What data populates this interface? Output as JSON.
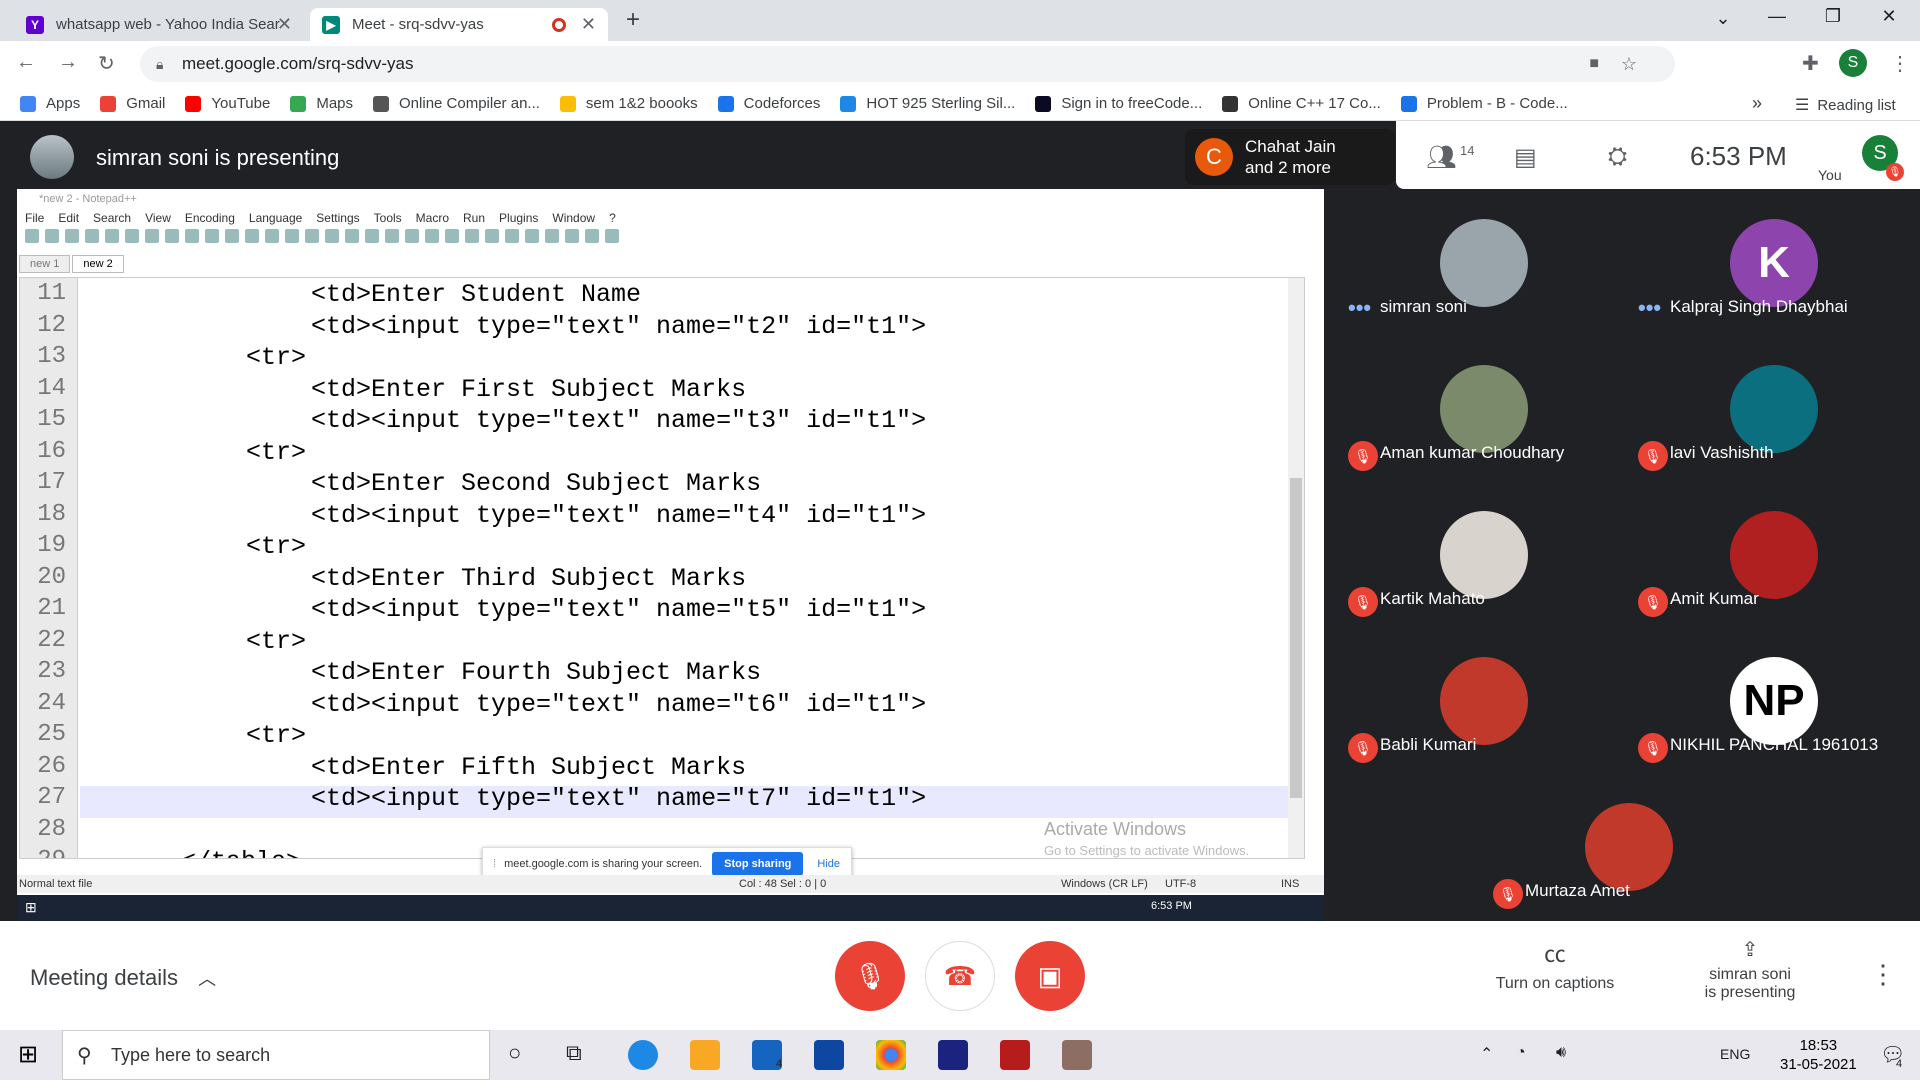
{
  "browser": {
    "tabs": [
      {
        "title": "whatsapp web - Yahoo India Sear",
        "favicon": "yahoo-icon",
        "active": false
      },
      {
        "title": "Meet - srq-sdvv-yas",
        "favicon": "meet-icon",
        "active": true
      }
    ],
    "new_tab": "+",
    "url": "meet.google.com/srq-sdvv-yas",
    "profile_initial": "S",
    "bookmarks": [
      {
        "label": "Apps",
        "icon": "apps-grid-icon",
        "color": "#4285f4"
      },
      {
        "label": "Gmail",
        "icon": "gmail-icon",
        "color": "#ea4335"
      },
      {
        "label": "YouTube",
        "icon": "youtube-icon",
        "color": "#ff0000"
      },
      {
        "label": "Maps",
        "icon": "maps-icon",
        "color": "#34a853"
      },
      {
        "label": "Online Compiler an...",
        "icon": "compiler-icon",
        "color": "#555555"
      },
      {
        "label": "sem 1&2 boooks",
        "icon": "drive-icon",
        "color": "#fbbc04"
      },
      {
        "label": "Codeforces",
        "icon": "codeforces-icon",
        "color": "#1a73e8"
      },
      {
        "label": "HOT 925 Sterling Sil...",
        "icon": "shop-icon",
        "color": "#1e88e5"
      },
      {
        "label": "Sign in to freeCode...",
        "icon": "freecodecamp-icon",
        "color": "#0a0a23"
      },
      {
        "label": "Online C++ 17 Co...",
        "icon": "cpp-icon",
        "color": "#333333"
      },
      {
        "label": "Problem - B - Code...",
        "icon": "codeforces-icon",
        "color": "#1a73e8"
      }
    ],
    "bookmarks_overflow": "»",
    "reading_list": "Reading list"
  },
  "meet": {
    "presenting_title": "simran soni is presenting",
    "notification": {
      "initial": "C",
      "line1": "Chahat Jain",
      "line2": "and 2 more"
    },
    "participant_count": "14",
    "time": "6:53 PM",
    "you_label": "You",
    "you_initial": "S",
    "participants": [
      {
        "name": "simran soni",
        "avatar": "photo",
        "color": "#9aa5ab",
        "status": "speaking"
      },
      {
        "name": "Kalpraj Singh Dhaybhai",
        "avatar": "K",
        "color": "#8e44ad",
        "status": "speaking"
      },
      {
        "name": "Aman kumar Choudhary",
        "avatar": "photo",
        "color": "#7a8a6a",
        "status": "muted"
      },
      {
        "name": "lavi Vashishth",
        "avatar": "photo",
        "color": "#0b6f7f",
        "status": "muted"
      },
      {
        "name": "Kartik Mahato",
        "avatar": "photo",
        "color": "#d8d3cc",
        "status": "muted"
      },
      {
        "name": "Amit Kumar",
        "avatar": "photo",
        "color": "#b12020",
        "status": "muted"
      },
      {
        "name": "Babli Kumari",
        "avatar": "photo",
        "color": "#c0392b",
        "status": "muted"
      },
      {
        "name": "NIKHIL PANCHAL 1961013",
        "avatar": "NP",
        "color": "#ffffff",
        "status": "muted"
      },
      {
        "name": "Murtaza Amet",
        "avatar": "photo",
        "color": "#c0392b",
        "status": "muted"
      }
    ],
    "meeting_details": "Meeting details",
    "captions_label": "Turn on captions",
    "presenting_label_1": "simran soni",
    "presenting_label_2": "is presenting"
  },
  "notepad": {
    "title": "*new 2 - Notepad++",
    "menu": [
      "File",
      "Edit",
      "Search",
      "View",
      "Encoding",
      "Language",
      "Settings",
      "Tools",
      "Macro",
      "Run",
      "Plugins",
      "Window",
      "?"
    ],
    "tabs": [
      "new 1",
      "new 2"
    ],
    "lines": [
      {
        "n": "11",
        "text": "<td>Enter Student Name",
        "indent": 3
      },
      {
        "n": "12",
        "text": "<td><input type=\"text\" name=\"t2\" id=\"t1\">",
        "indent": 3
      },
      {
        "n": "13",
        "text": "<tr>",
        "indent": 2
      },
      {
        "n": "14",
        "text": "<td>Enter First Subject Marks",
        "indent": 3
      },
      {
        "n": "15",
        "text": "<td><input type=\"text\" name=\"t3\" id=\"t1\">",
        "indent": 3
      },
      {
        "n": "16",
        "text": "<tr>",
        "indent": 2
      },
      {
        "n": "17",
        "text": "<td>Enter Second Subject Marks",
        "indent": 3
      },
      {
        "n": "18",
        "text": "<td><input type=\"text\" name=\"t4\" id=\"t1\">",
        "indent": 3
      },
      {
        "n": "19",
        "text": "<tr>",
        "indent": 2
      },
      {
        "n": "20",
        "text": "<td>Enter Third Subject Marks",
        "indent": 3
      },
      {
        "n": "21",
        "text": "<td><input type=\"text\" name=\"t5\" id=\"t1\">",
        "indent": 3
      },
      {
        "n": "22",
        "text": "<tr>",
        "indent": 2
      },
      {
        "n": "23",
        "text": "<td>Enter Fourth Subject Marks",
        "indent": 3
      },
      {
        "n": "24",
        "text": "<td><input type=\"text\" name=\"t6\" id=\"t1\">",
        "indent": 3
      },
      {
        "n": "25",
        "text": "<tr>",
        "indent": 2
      },
      {
        "n": "26",
        "text": "<td>Enter Fifth Subject Marks",
        "indent": 3
      },
      {
        "n": "27",
        "text": "<td><input type=\"text\" name=\"t7\" id=\"t1\">",
        "indent": 3
      },
      {
        "n": "28",
        "text": "",
        "indent": 0
      },
      {
        "n": "29",
        "text": "</table>",
        "indent": 1
      }
    ],
    "share_notice": "meet.google.com is sharing your screen.",
    "stop_sharing": "Stop sharing",
    "hide": "Hide",
    "watermark_1": "Activate Windows",
    "watermark_2": "Go to Settings to activate Windows.",
    "status": {
      "type": "Normal text file",
      "pos": "Col : 48   Sel : 0 | 0",
      "eol": "Windows (CR LF)",
      "enc": "UTF-8",
      "mode": "INS"
    },
    "inner_clock": "6:53 PM"
  },
  "taskbar": {
    "search_placeholder": "Type here to search",
    "lang": "ENG",
    "time": "18:53",
    "date": "31-05-2021",
    "mail_badge": "4",
    "notif_count": "4"
  }
}
